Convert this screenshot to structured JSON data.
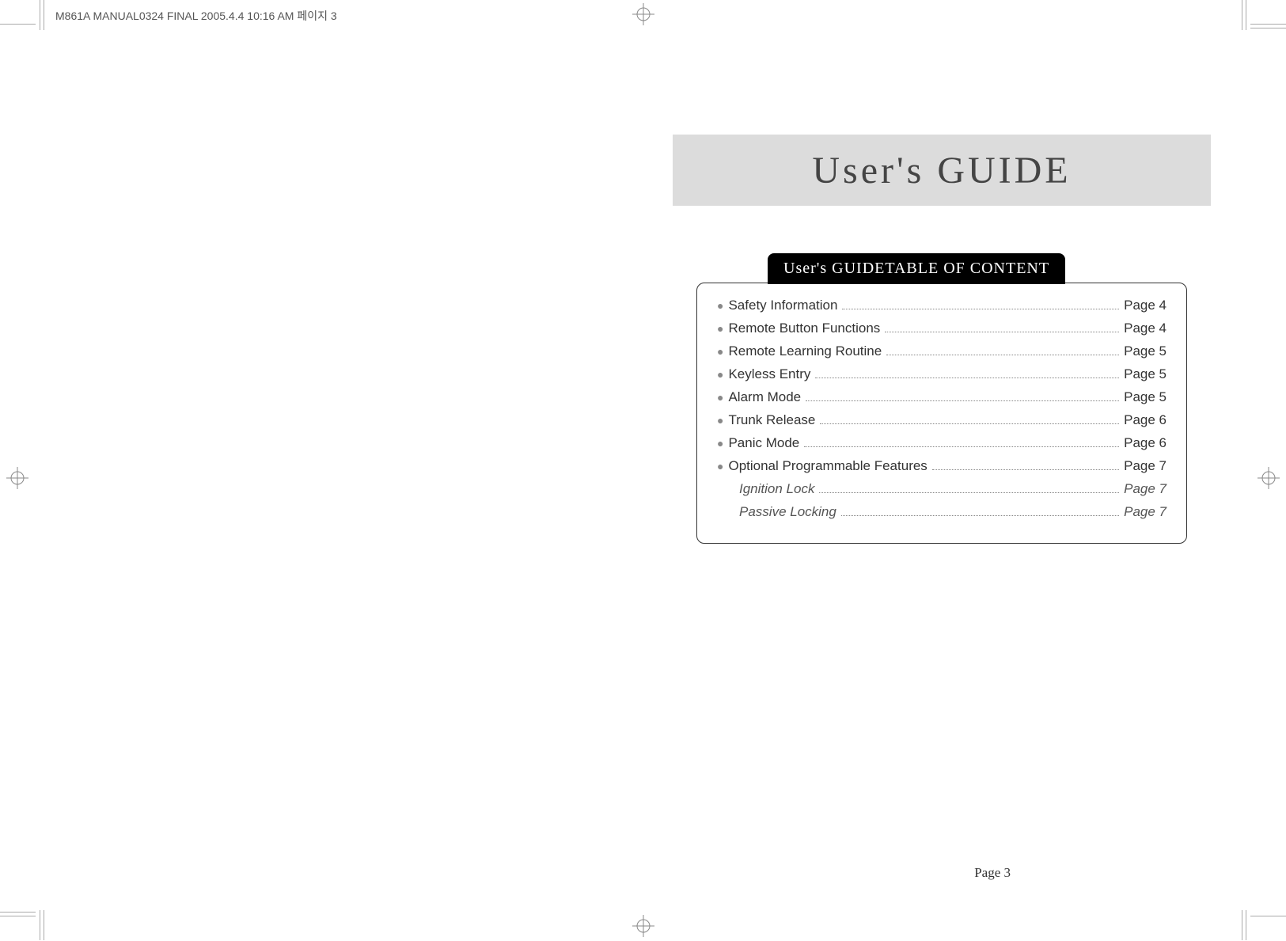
{
  "header_info": "M861A MANUAL0324 FINAL  2005.4.4  10:16 AM  페이지 3",
  "title": "User's GUIDE",
  "toc_header": "User's GUIDETABLE OF CONTENT",
  "toc": [
    {
      "label": "Safety Information",
      "page": "Page 4",
      "sub": false
    },
    {
      "label": "Remote Button Functions",
      "page": "Page 4",
      "sub": false
    },
    {
      "label": "Remote Learning Routine",
      "page": "Page 5",
      "sub": false
    },
    {
      "label": "Keyless Entry",
      "page": "Page 5",
      "sub": false
    },
    {
      "label": "Alarm Mode",
      "page": "Page 5",
      "sub": false
    },
    {
      "label": "Trunk Release",
      "page": "Page 6",
      "sub": false
    },
    {
      "label": "Panic Mode",
      "page": "Page 6",
      "sub": false
    },
    {
      "label": "Optional Programmable Features",
      "page": "Page 7",
      "sub": false
    },
    {
      "label": "Ignition Lock",
      "page": "Page 7",
      "sub": true
    },
    {
      "label": "Passive Locking",
      "page": "Page 7",
      "sub": true
    }
  ],
  "page_number": "Page 3"
}
